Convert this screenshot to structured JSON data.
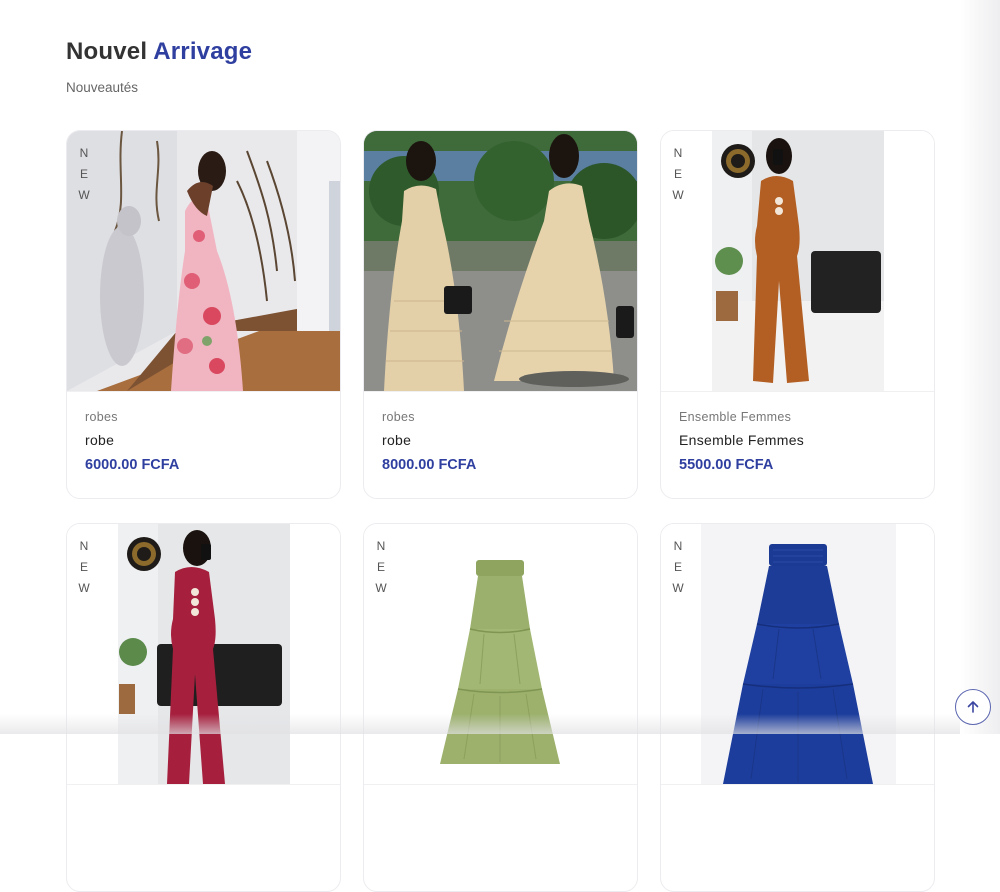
{
  "section": {
    "title_part1": "Nouvel",
    "title_part2": "Arrivage",
    "subtitle": "Nouveautés"
  },
  "badge": {
    "new_letters": [
      "N",
      "E",
      "W"
    ]
  },
  "products": [
    {
      "category": "robes",
      "name": "robe",
      "price": "6000.00 FCFA",
      "image": "floral-maxi-dress-photo"
    },
    {
      "category": "robes",
      "name": "robe",
      "price": "8000.00 FCFA",
      "image": "beige-pleated-dress-photo"
    },
    {
      "category": "Ensemble Femmes",
      "name": "Ensemble Femmes",
      "price": "5500.00 FCFA",
      "image": "rust-jumpsuit-set-photo"
    },
    {
      "category": "",
      "name": "",
      "price": "",
      "image": "burgundy-jumpsuit-set-photo"
    },
    {
      "category": "",
      "name": "",
      "price": "",
      "image": "green-tiered-skirt-photo"
    },
    {
      "category": "",
      "name": "",
      "price": "",
      "image": "blue-tiered-skirt-photo"
    }
  ],
  "scroll_top": {
    "icon": "arrow-up-icon"
  },
  "colors": {
    "accent": "#2f3fa0",
    "text": "#333333",
    "muted": "#666666"
  }
}
